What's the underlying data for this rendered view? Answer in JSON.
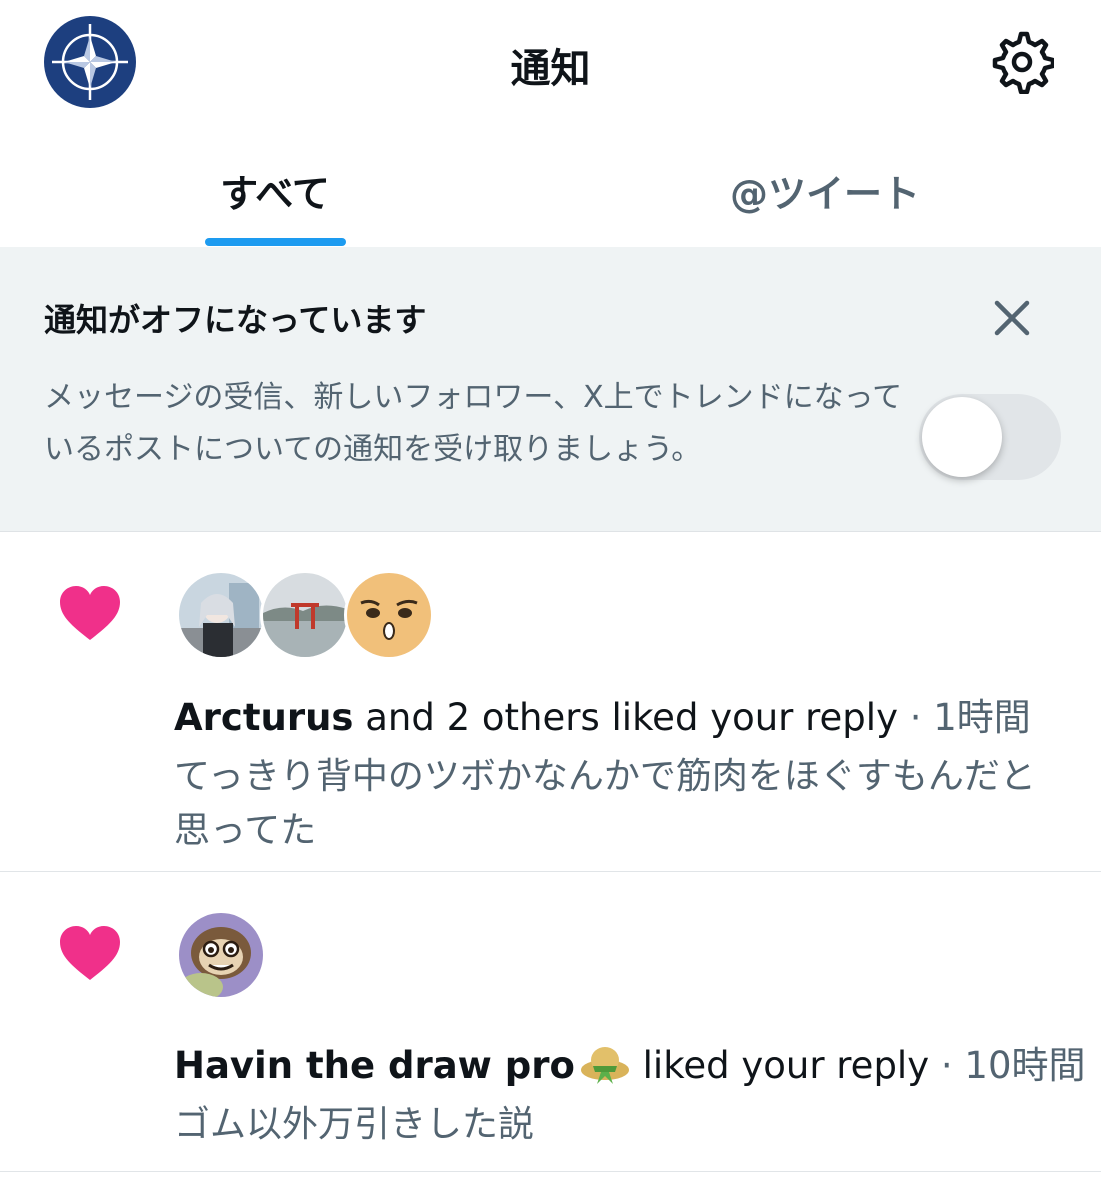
{
  "header": {
    "title": "通知",
    "avatar_icon": "compass-star-icon",
    "settings_icon": "gear-icon"
  },
  "tabs": [
    {
      "label": "すべて",
      "active": true
    },
    {
      "label": "@ツイート",
      "active": false
    }
  ],
  "banner": {
    "title": "通知がオフになっています",
    "body": "メッセージの受信、新しいフォロワー、X上でトレンドになっているポストについての通知を受け取りましょう。",
    "toggle_on": false
  },
  "notifications": [
    {
      "icon": "heart-icon",
      "name": "Arcturus",
      "action": " and 2 others liked your reply",
      "time": " · 1時間",
      "preview": "てっきり背中のツボかなんかで筋肉をほぐすもんだと思ってた"
    },
    {
      "icon": "heart-icon",
      "name": "Havin the draw pro",
      "action": " liked your reply",
      "time": " · 10時間",
      "preview": "ゴム以外万引きした説"
    }
  ],
  "colors": {
    "accent": "#1d9bf0",
    "heart": "#f91880",
    "banner_bg": "#eff3f4",
    "secondary_text": "#536471"
  }
}
